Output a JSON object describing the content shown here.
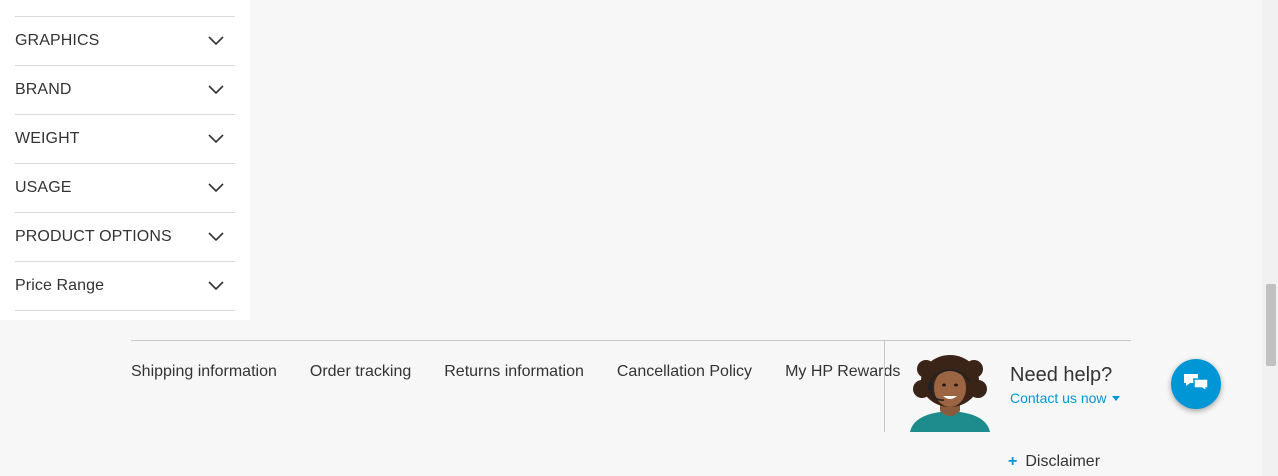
{
  "filters": [
    {
      "label": "GRAPHICS"
    },
    {
      "label": "BRAND"
    },
    {
      "label": "WEIGHT"
    },
    {
      "label": "USAGE"
    },
    {
      "label": "PRODUCT OPTIONS"
    },
    {
      "label": "Price Range"
    }
  ],
  "footer": {
    "links": [
      {
        "label": "Shipping information"
      },
      {
        "label": "Order tracking"
      },
      {
        "label": "Returns information"
      },
      {
        "label": "Cancellation Policy"
      },
      {
        "label": "My HP Rewards"
      }
    ],
    "help_title": "Need help?",
    "contact_label": "Contact us now",
    "disclaimer_label": "Disclaimer"
  },
  "icons": {
    "filter_chevron": "chevron-down-icon",
    "chat": "chat-bubbles-icon",
    "contact_caret": "caret-down-icon",
    "disclaimer_plus": "plus-icon"
  },
  "colors": {
    "accent": "#0096d6",
    "page_bg": "#f8f7f7"
  }
}
